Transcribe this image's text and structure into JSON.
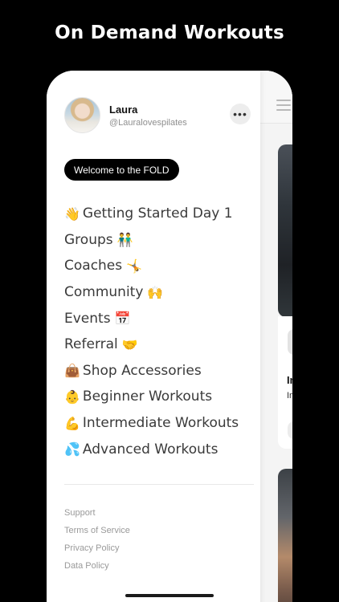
{
  "headline": "On Demand Workouts",
  "user": {
    "name": "Laura",
    "handle": "@Lauralovespilates"
  },
  "more_button": {
    "label": "•••",
    "icon": "more-icon"
  },
  "welcome_badge": "Welcome to the FOLD",
  "menu": [
    {
      "prefix": "👋",
      "label": "Getting Started Day 1",
      "suffix": ""
    },
    {
      "prefix": "",
      "label": "Groups",
      "suffix": "👬"
    },
    {
      "prefix": "",
      "label": "Coaches",
      "suffix": "🤸"
    },
    {
      "prefix": "",
      "label": "Community",
      "suffix": "🙌"
    },
    {
      "prefix": "",
      "label": "Events",
      "suffix": "📅"
    },
    {
      "prefix": "",
      "label": "Referral",
      "suffix": "🤝"
    },
    {
      "prefix": "👜",
      "label": "Shop Accessories",
      "suffix": ""
    },
    {
      "prefix": "👶",
      "label": "Beginner Workouts",
      "suffix": ""
    },
    {
      "prefix": "💪",
      "label": "Intermediate Workouts",
      "suffix": ""
    },
    {
      "prefix": "💦",
      "label": "Advanced Workouts",
      "suffix": ""
    }
  ],
  "footer_links": [
    "Support",
    "Terms of Service",
    "Privacy Policy",
    "Data Policy"
  ],
  "background": {
    "card_title_fragment": "In",
    "card_subtitle_fragment": "In"
  },
  "colors": {
    "screen_bg": "#000000",
    "badge_bg": "#000000",
    "menu_text": "#3a3a3a",
    "footer_text": "#9a9a9a"
  }
}
